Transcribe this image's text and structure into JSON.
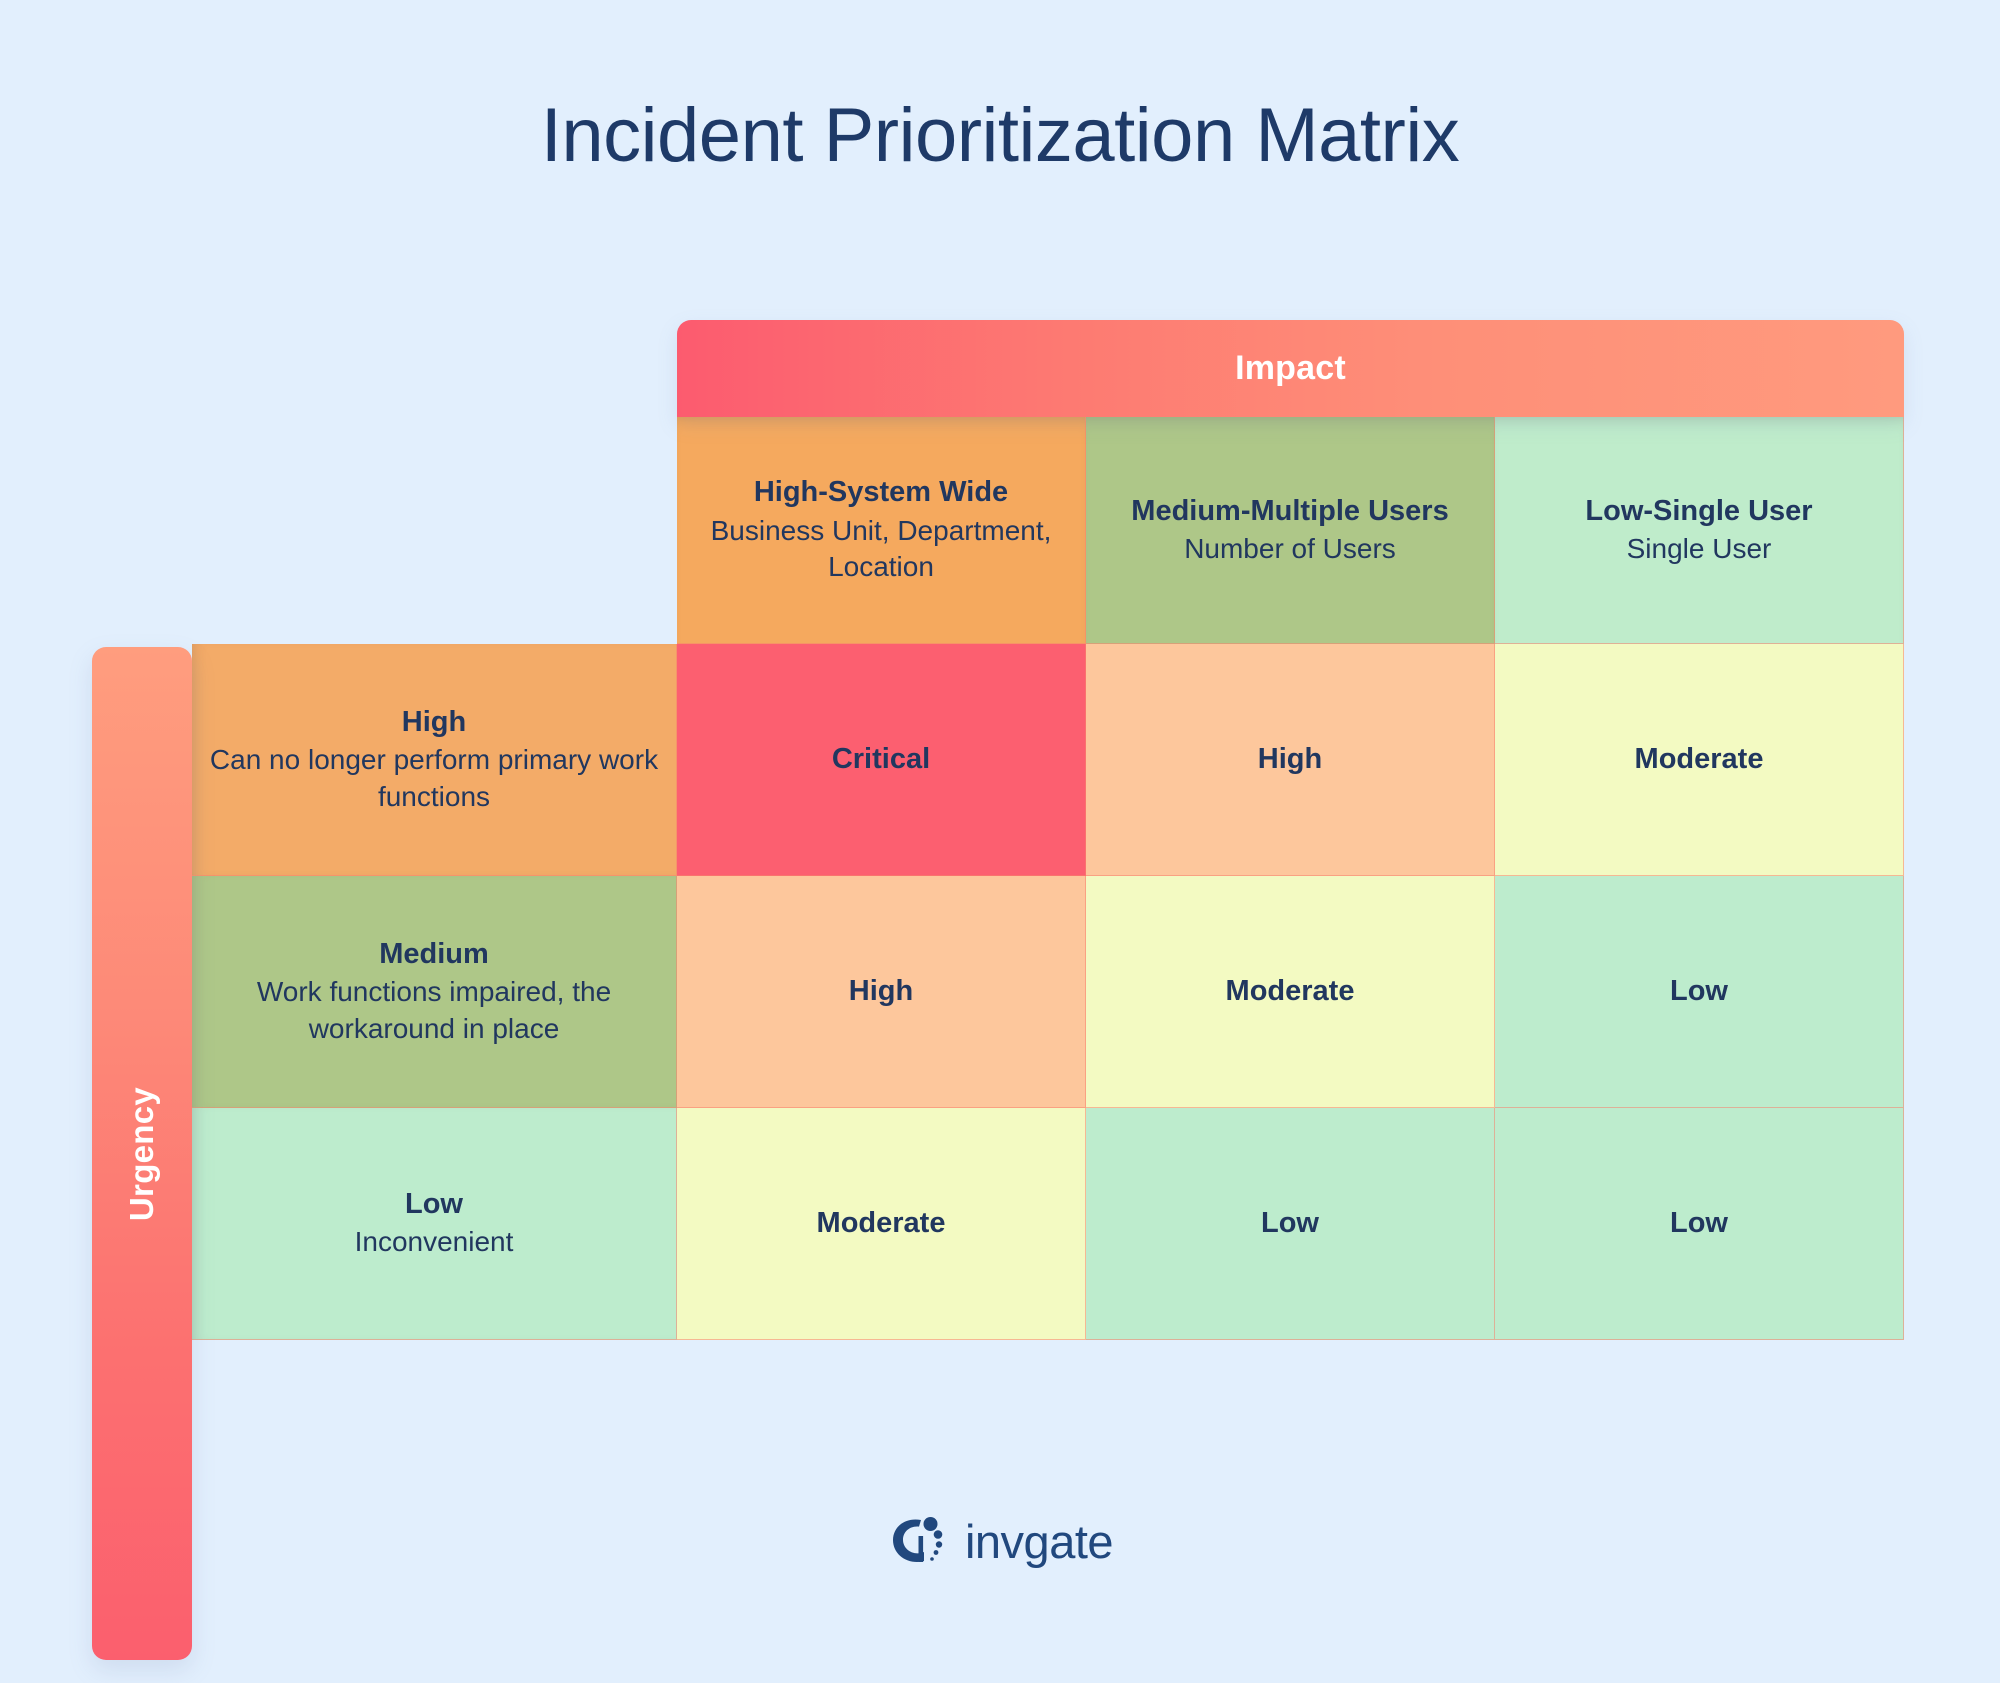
{
  "page": {
    "title": "Incident Prioritization Matrix",
    "background_color": "#e2effd",
    "text_color": "#21375f"
  },
  "axes": {
    "impact_label": "Impact",
    "urgency_label": "Urgency"
  },
  "chart_data": {
    "type": "table",
    "title": "Incident Prioritization Matrix",
    "xlabel": "Impact",
    "ylabel": "Urgency",
    "columns": [
      {
        "title": "High-System Wide",
        "desc": "Business Unit, Department, Location",
        "color": "#f5a95e"
      },
      {
        "title": "Medium-Multiple Users",
        "desc": "Number of Users",
        "color": "#aec788"
      },
      {
        "title": "Low-Single User",
        "desc": "Single User",
        "color": "#bfeccb"
      }
    ],
    "rows": [
      {
        "title": "High",
        "desc": "Can no longer perform primary work functions",
        "color": "#f3ab68"
      },
      {
        "title": "Medium",
        "desc": "Work functions impaired, the workaround in place",
        "color": "#aec788"
      },
      {
        "title": "Low",
        "desc": "Inconvenient",
        "color": "#bdeccd"
      }
    ],
    "cells": [
      [
        {
          "value": "Critical",
          "color": "#fc5f70"
        },
        {
          "value": "High",
          "color": "#fdc79c"
        },
        {
          "value": "Moderate",
          "color": "#f3fac2"
        }
      ],
      [
        {
          "value": "High",
          "color": "#fdc79c"
        },
        {
          "value": "Moderate",
          "color": "#f3fac2"
        },
        {
          "value": "Low",
          "color": "#bdeccd"
        }
      ],
      [
        {
          "value": "Moderate",
          "color": "#f3fac2"
        },
        {
          "value": "Low",
          "color": "#bdeccd"
        },
        {
          "value": "Low",
          "color": "#bdeccd"
        }
      ]
    ],
    "legend": [],
    "grid": true
  },
  "footer": {
    "brand": "invgate",
    "brand_color": "#21487e"
  }
}
